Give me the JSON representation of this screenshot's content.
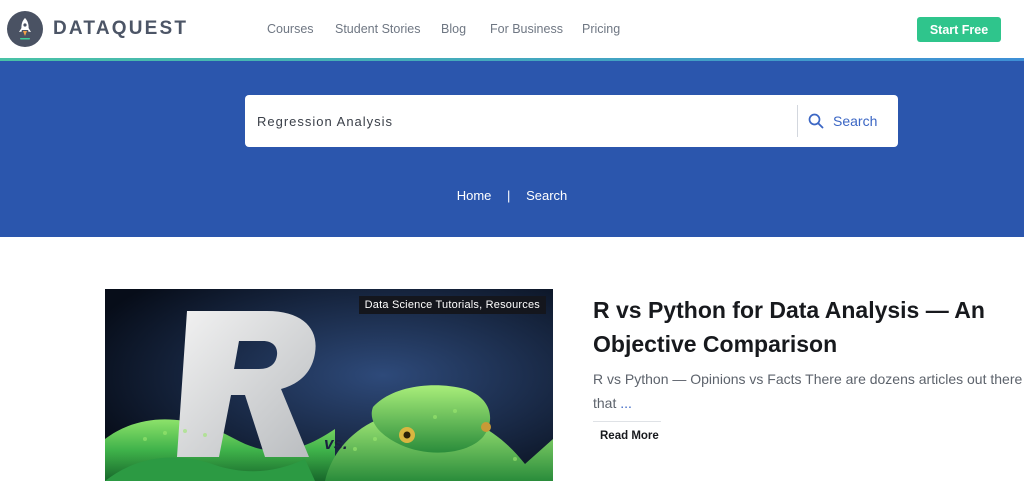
{
  "header": {
    "logo_text": "DATAQUEST",
    "nav": [
      {
        "label": "Courses"
      },
      {
        "label": "Student Stories"
      },
      {
        "label": "Blog"
      },
      {
        "label": "For Business"
      },
      {
        "label": "Pricing"
      }
    ],
    "cta_label": "Start Free"
  },
  "search": {
    "value": "Regression Analysis",
    "button_label": "Search",
    "icon": "search-icon"
  },
  "breadcrumb": {
    "home": "Home",
    "separator": "|",
    "current": "Search"
  },
  "result": {
    "category": "Data Science Tutorials, Resources",
    "title": "R vs Python for Data Analysis — An Objective Comparison",
    "excerpt_line1": "R vs Python — Opinions vs Facts There are dozens articles out there",
    "excerpt_line2": "that",
    "ellipsis": "...",
    "read_more": "Read More",
    "image_text_big": "R",
    "image_text_small": "vs."
  },
  "colors": {
    "hero_bg": "#2b56ad",
    "cta_bg": "#2fc58c",
    "accent_blue": "#3b66c4"
  }
}
